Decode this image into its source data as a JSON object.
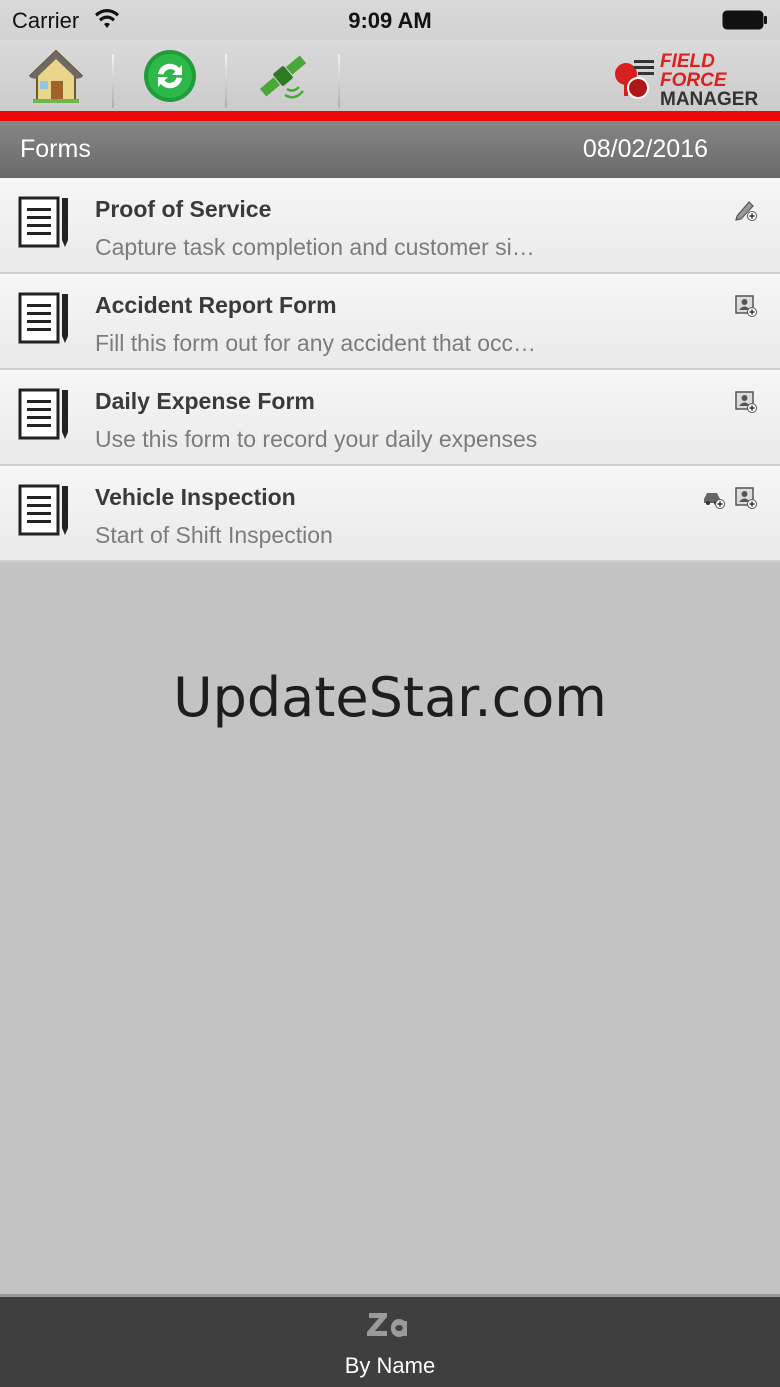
{
  "status_bar": {
    "carrier": "Carrier",
    "time": "9:09 AM",
    "wifi_icon": "wifi-icon",
    "battery_icon": "battery-icon"
  },
  "toolbar": {
    "buttons": [
      {
        "icon": "home-icon"
      },
      {
        "icon": "sync-icon"
      },
      {
        "icon": "satellite-icon"
      }
    ],
    "logo": {
      "line1": "FIELD",
      "line2": "FORCE",
      "line3": "MANAGER"
    },
    "accent_color": "#ea0a0a"
  },
  "header": {
    "title": "Forms",
    "date": "08/02/2016"
  },
  "forms": [
    {
      "name": "Proof of Service",
      "description": "Capture task completion and customer si…",
      "actions": [
        "edit-add-icon"
      ]
    },
    {
      "name": "Accident Report Form",
      "description": "Fill this form out for any accident that occ…",
      "actions": [
        "contact-add-icon"
      ]
    },
    {
      "name": "Daily Expense Form",
      "description": "Use this form to record your daily expenses",
      "actions": [
        "contact-add-icon"
      ]
    },
    {
      "name": "Vehicle Inspection",
      "description": "Start of Shift Inspection",
      "actions": [
        "vehicle-add-icon",
        "contact-add-icon"
      ]
    }
  ],
  "watermark": "UpdateStar.com",
  "bottom_bar": {
    "sort_label": "By Name",
    "sort_icon": "sort-za-icon"
  }
}
